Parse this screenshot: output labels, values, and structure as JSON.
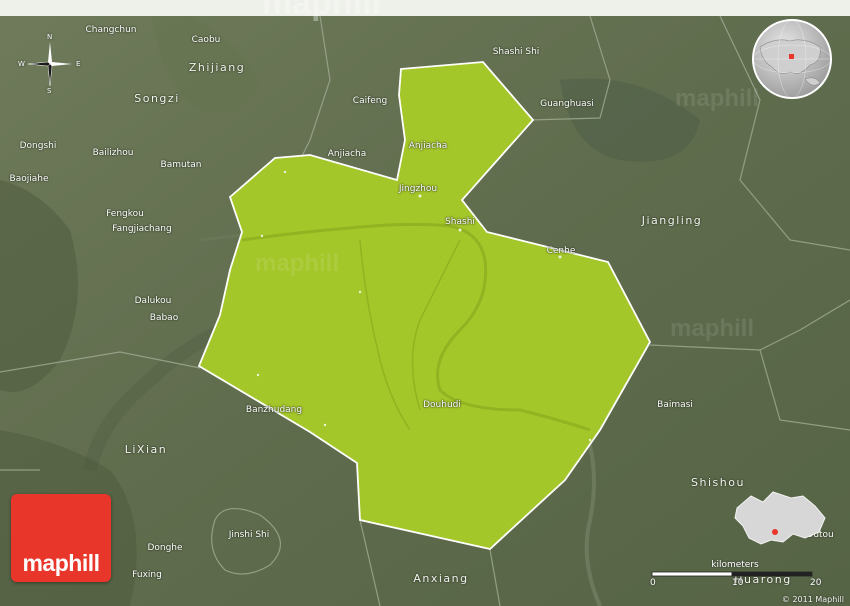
{
  "map": {
    "watermark": "maphill",
    "logo_text": "maphill",
    "copyright": "© 2011 Maphill",
    "compass": {
      "n": "N",
      "s": "S",
      "e": "E",
      "w": "W"
    },
    "scale": {
      "unit": "kilometers",
      "tick0": "0",
      "tick10": "10",
      "tick20": "20"
    },
    "colors": {
      "region_fill": "#a3c628",
      "region_stroke": "#ffffff",
      "terrain": "#5e6b4c",
      "logo_bg": "#e8362a"
    },
    "labels": {
      "changchun": "Changchun",
      "caobu": "Caobu",
      "zhijiang": "Zhijiang",
      "songzi": "Songzi",
      "shashi_shi": "Shashi Shi",
      "caifeng": "Caifeng",
      "guanghuasi": "Guanghuasi",
      "anjiacha_city": "Anjiacha",
      "anjiacha": "Anjiacha",
      "dongshi": "Dongshi",
      "bailizhou": "Bailizhou",
      "bamutan": "Bamutan",
      "baojiahe": "Baojiahe",
      "jingzhou": "Jingzhou",
      "shashi": "Shashi",
      "fengkou": "Fengkou",
      "fangjiachang": "Fangjiachang",
      "jiangling": "Jiangling",
      "cenhe": "Cenhe",
      "dalukou": "Dalukou",
      "babao": "Babao",
      "banzhudang": "Banzhudang",
      "douhudi": "Douhudi",
      "baimasi": "Baimasi",
      "lixian": "LiXian",
      "shishou": "Shishou",
      "jinshishi": "Jinshi Shi",
      "donghe": "Donghe",
      "fuxing": "Fuxing",
      "anxiang": "Anxiang",
      "huarong": "Huarong",
      "outou": "Outou"
    }
  }
}
